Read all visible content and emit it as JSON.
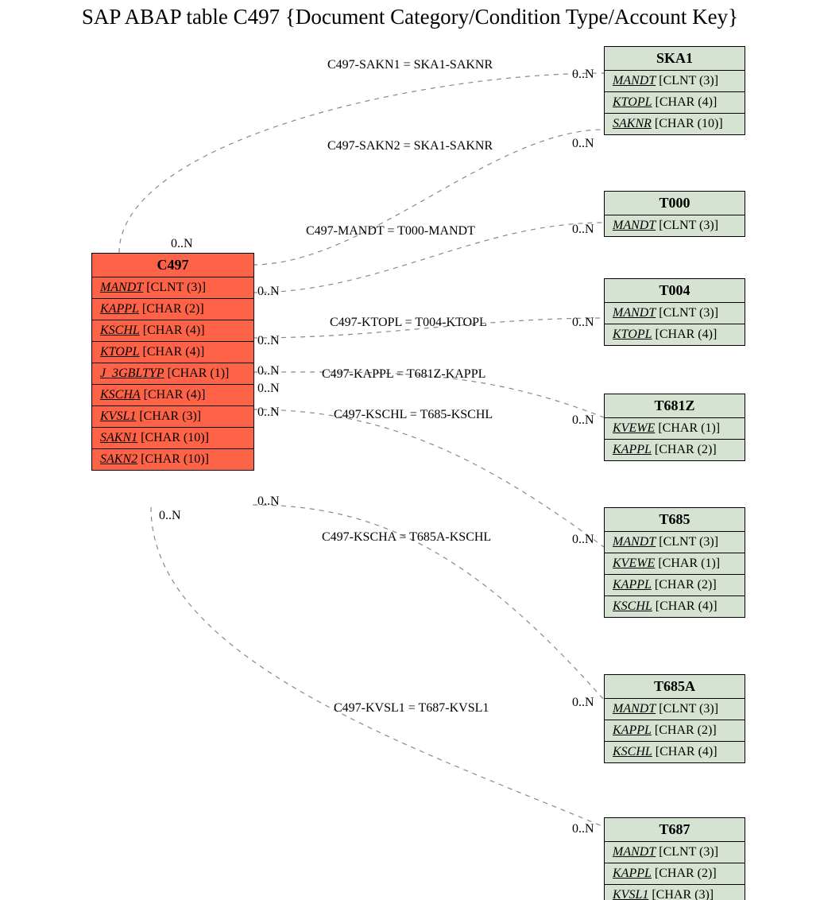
{
  "title": "SAP ABAP table C497 {Document Category/Condition Type/Account Key}",
  "main": {
    "name": "C497",
    "rows": [
      {
        "k": "MANDT",
        "t": "[CLNT (3)]"
      },
      {
        "k": "KAPPL",
        "t": "[CHAR (2)]"
      },
      {
        "k": "KSCHL",
        "t": "[CHAR (4)]"
      },
      {
        "k": "KTOPL",
        "t": "[CHAR (4)]"
      },
      {
        "k": "J_3GBLTYP",
        "t": "[CHAR (1)]"
      },
      {
        "k": "KSCHA",
        "t": "[CHAR (4)]"
      },
      {
        "k": "KVSL1",
        "t": "[CHAR (3)]"
      },
      {
        "k": "SAKN1",
        "t": "[CHAR (10)]"
      },
      {
        "k": "SAKN2",
        "t": "[CHAR (10)]"
      }
    ]
  },
  "targets": [
    {
      "name": "SKA1",
      "rows": [
        {
          "k": "MANDT",
          "t": "[CLNT (3)]"
        },
        {
          "k": "KTOPL",
          "t": "[CHAR (4)]"
        },
        {
          "k": "SAKNR",
          "t": "[CHAR (10)]"
        }
      ]
    },
    {
      "name": "T000",
      "rows": [
        {
          "k": "MANDT",
          "t": "[CLNT (3)]"
        }
      ]
    },
    {
      "name": "T004",
      "rows": [
        {
          "k": "MANDT",
          "t": "[CLNT (3)]"
        },
        {
          "k": "KTOPL",
          "t": "[CHAR (4)]"
        }
      ]
    },
    {
      "name": "T681Z",
      "rows": [
        {
          "k": "KVEWE",
          "t": "[CHAR (1)]"
        },
        {
          "k": "KAPPL",
          "t": "[CHAR (2)]"
        }
      ]
    },
    {
      "name": "T685",
      "rows": [
        {
          "k": "MANDT",
          "t": "[CLNT (3)]"
        },
        {
          "k": "KVEWE",
          "t": "[CHAR (1)]"
        },
        {
          "k": "KAPPL",
          "t": "[CHAR (2)]"
        },
        {
          "k": "KSCHL",
          "t": "[CHAR (4)]"
        }
      ]
    },
    {
      "name": "T685A",
      "rows": [
        {
          "k": "MANDT",
          "t": "[CLNT (3)]"
        },
        {
          "k": "KAPPL",
          "t": "[CHAR (2)]"
        },
        {
          "k": "KSCHL",
          "t": "[CHAR (4)]"
        }
      ]
    },
    {
      "name": "T687",
      "rows": [
        {
          "k": "MANDT",
          "t": "[CLNT (3)]"
        },
        {
          "k": "KAPPL",
          "t": "[CHAR (2)]"
        },
        {
          "k": "KVSL1",
          "t": "[CHAR (3)]"
        }
      ]
    }
  ],
  "relations": [
    {
      "label": "C497-SAKN1 = SKA1-SAKNR"
    },
    {
      "label": "C497-SAKN2 = SKA1-SAKNR"
    },
    {
      "label": "C497-MANDT = T000-MANDT"
    },
    {
      "label": "C497-KTOPL = T004-KTOPL"
    },
    {
      "label": "C497-KAPPL = T681Z-KAPPL"
    },
    {
      "label": "C497-KSCHL = T685-KSCHL"
    },
    {
      "label": "C497-KSCHA = T685A-KSCHL"
    },
    {
      "label": "C497-KVSL1 = T687-KVSL1"
    }
  ],
  "cards": {
    "src0": "0..N",
    "src1": "0..N",
    "src2": "0..N",
    "src3": "0..N",
    "src4": "0..N",
    "src5": "0..N",
    "src6": "0..N",
    "src7": "0..N",
    "dst0": "0..N",
    "dst1": "0..N",
    "dst2": "0..N",
    "dst3": "0..N",
    "dst4": "0..N",
    "dst5": "0..N",
    "dst6": "0..N",
    "dst7": "0..N"
  }
}
